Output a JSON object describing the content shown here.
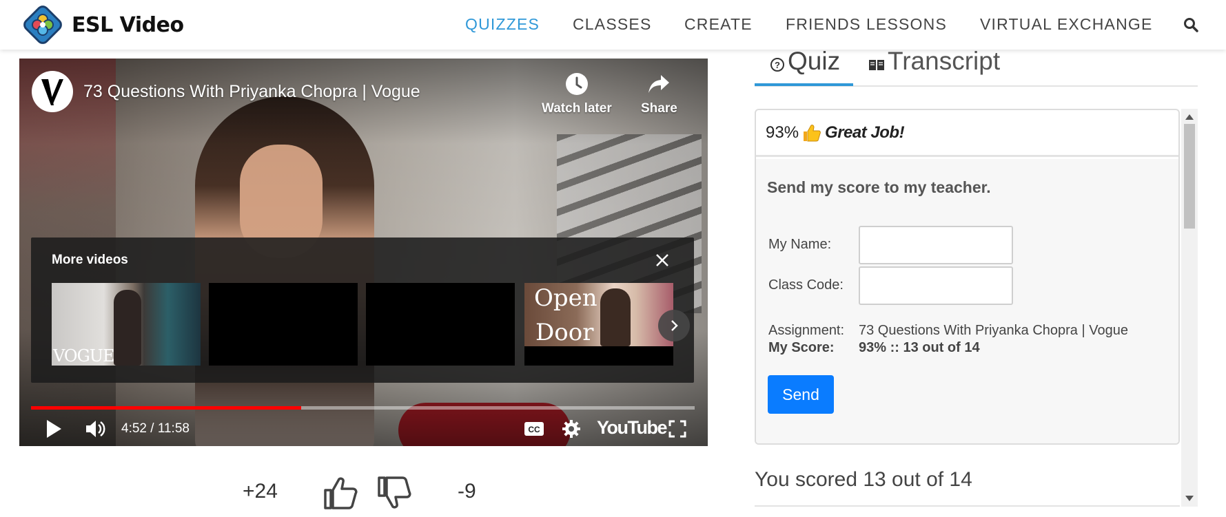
{
  "header": {
    "brand": "ESL Video",
    "nav": [
      {
        "label": "QUIZZES",
        "active": true
      },
      {
        "label": "CLASSES",
        "active": false
      },
      {
        "label": "CREATE",
        "active": false
      },
      {
        "label": "FRIENDS LESSONS",
        "active": false
      },
      {
        "label": "VIRTUAL EXCHANGE",
        "active": false
      }
    ],
    "search_icon": "search-icon",
    "accent_color": "#2f98d8"
  },
  "video": {
    "title": "73 Questions With Priyanka Chopra | Vogue",
    "watch_later_label": "Watch later",
    "share_label": "Share",
    "more_videos_label": "More videos",
    "thumb1_caption": "VOGUE",
    "thumb4_caption_line1": "Open",
    "thumb4_caption_line2": "Door",
    "time_display": "4:52 / 11:58",
    "progress_fraction": 0.407,
    "youtube_label": "YouTube",
    "progress_color": "#ff0000"
  },
  "votes": {
    "up_count": "+24",
    "down_count": "-9"
  },
  "panel": {
    "tabs": [
      {
        "label": "Quiz",
        "icon": "question-circle-icon",
        "active": true
      },
      {
        "label": "Transcript",
        "icon": "book-icon",
        "active": false
      }
    ],
    "score_percent": "93%",
    "score_message": "Great Job!",
    "send_title": "Send my score to my teacher.",
    "name_label": "My Name:",
    "name_value": "",
    "class_code_label": "Class Code:",
    "class_code_value": "",
    "assignment_label": "Assignment:",
    "assignment_value": "73 Questions With Priyanka Chopra | Vogue",
    "my_score_label": "My Score:",
    "my_score_value": "93% :: 13 out of 14",
    "send_button": "Send",
    "send_button_color": "#0a7cff",
    "scored_text": "You scored 13 out of 14"
  }
}
